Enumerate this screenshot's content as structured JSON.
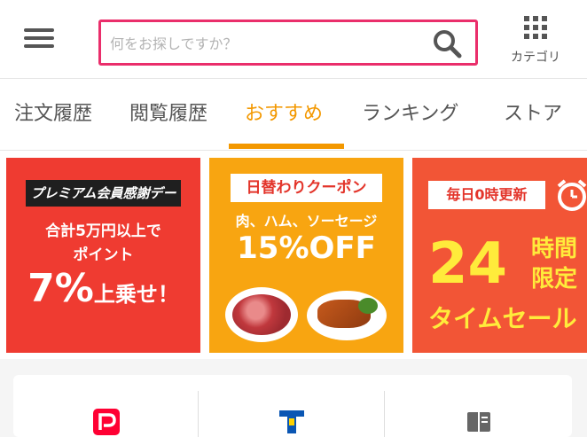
{
  "header": {
    "menu_icon": "hamburger-icon",
    "search": {
      "placeholder": "何をお探しですか？",
      "value": "",
      "icon": "search-icon",
      "border_color": "#ea2e6b"
    },
    "category": {
      "label": "カテゴリ",
      "icon": "grid-icon"
    }
  },
  "tabs": {
    "items": [
      {
        "label": "注文履歴"
      },
      {
        "label": "閲覧履歴"
      },
      {
        "label": "おすすめ",
        "active": true
      },
      {
        "label": "ランキング"
      },
      {
        "label": "ストア"
      }
    ],
    "active_color": "#f39800"
  },
  "banners": [
    {
      "badge": "プレミアム会員感謝デー",
      "line1": "合計5万円以上で",
      "line2": "ポイント",
      "big_number": "7%",
      "big_suffix": "上乗せ！",
      "color": "#ef3b31"
    },
    {
      "badge": "日替わりクーポン",
      "line1": "肉、ハム、ソーセージ",
      "big": "15%OFF",
      "color": "#f8a511"
    },
    {
      "badge": "毎日0時更新",
      "big_number": "24",
      "side1": "時間",
      "side2": "限定",
      "footer": "タイムセール",
      "icon": "alarm-clock-icon",
      "color": "#f25536"
    }
  ],
  "services": [
    {
      "icon": "paypay-icon",
      "color": "#ff0033"
    },
    {
      "icon": "tpoint-icon",
      "color": "#0a56b3"
    },
    {
      "icon": "book-icon",
      "color": "#666666"
    }
  ]
}
